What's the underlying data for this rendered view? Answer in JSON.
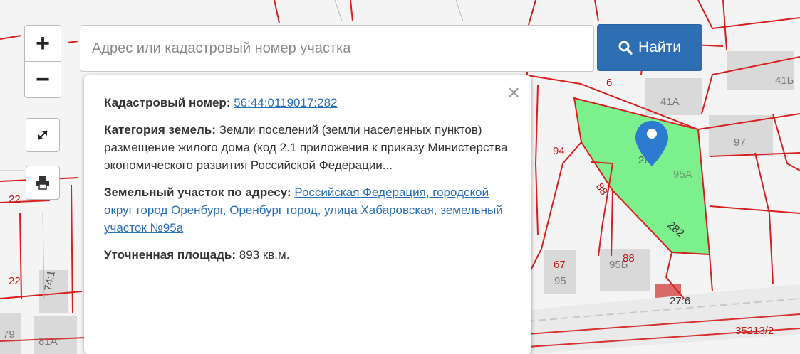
{
  "search": {
    "placeholder": "Адрес или кадастровый номер участка",
    "button_label": "Найти"
  },
  "controls": {
    "zoom_in": "+",
    "zoom_out": "−"
  },
  "popup": {
    "close": "×",
    "cadastral_label": "Кадастровый номер:",
    "cadastral_value": "56:44:0119017:282",
    "category_label": "Категория земель:",
    "category_value": "Земли поселений (земли населенных пунктов)",
    "usage": "размещение жилого дома (код 2.1 приложения к приказу Министерства экономического развития Российской Федерации...",
    "address_label": "Земельный участок по адресу:",
    "address_value": "Российская Федерация, городской округ город Оренбург, Оренбург город, улица Хабаровская, земельный участок №95а",
    "area_label": "Уточненная площадь:",
    "area_value": "893 кв.м."
  },
  "map_labels": {
    "l_6": "6",
    "l_41a": "41А",
    "l_41b": "41Б",
    "l_97": "97",
    "l_94": "94",
    "l_88a": "88",
    "l_95a": "95А",
    "l_282": "282",
    "l_28": "28",
    "l_67": "67",
    "l_95": "95",
    "l_95b": "95Б",
    "l_88b": "88",
    "l_276": "27:6",
    "l_35213": "35213/2",
    "l_22a": "22",
    "l_22b": "22",
    "l_74": "74:1",
    "l_79": "79",
    "l_81a": "81А"
  },
  "colors": {
    "parcel_fill": "#7cf08c",
    "boundary": "#d81e1e",
    "marker": "#2c7bd0",
    "accent": "#2e6fb4"
  }
}
